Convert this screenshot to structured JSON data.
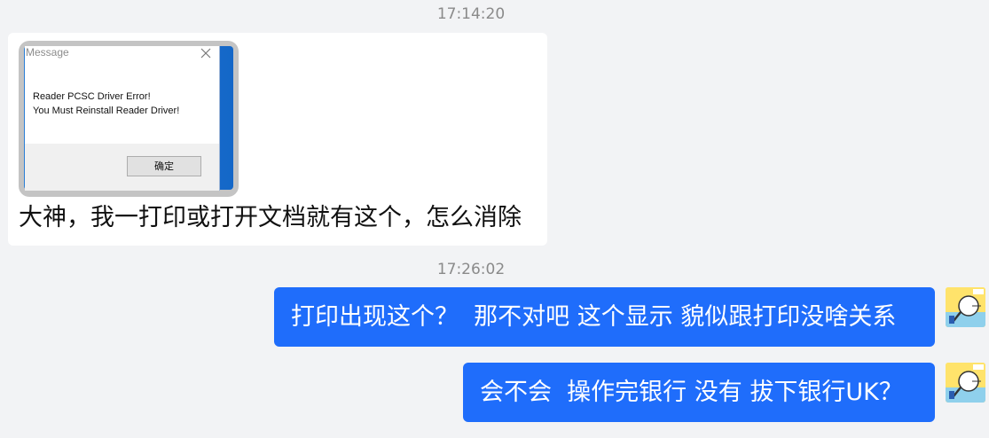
{
  "chat": {
    "timestamp_1": "17:14:20",
    "timestamp_2": "17:26:02",
    "incoming": {
      "screenshot": {
        "title": "Message",
        "line1": "Reader PCSC Driver Error!",
        "line2": "You Must Reinstall Reader Driver!",
        "ok_label": "确定"
      },
      "text": "大神，我一打印或打开文档就有这个，怎么消除"
    },
    "outgoing": [
      {
        "text": "打印出现这个？  那不对吧 这个显示 貌似跟打印没啥关系"
      },
      {
        "text": "会不会  操作完银行 没有 拔下银行UK？"
      }
    ]
  },
  "colors": {
    "background": "#f2f3f5",
    "incoming_bubble": "#ffffff",
    "outgoing_bubble": "#1f6dfb",
    "timestamp": "#8a8a8a",
    "avatar_bg": "#ffe36b"
  },
  "icons": [
    "close-icon",
    "avatar-icon"
  ]
}
